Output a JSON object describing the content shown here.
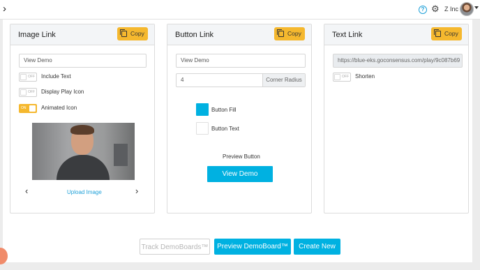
{
  "topbar": {
    "back_icon": "chevron-right-icon",
    "help_icon": "?",
    "settings_icon": "gear-icon",
    "org_name": "Z Inc",
    "avatar_icon": "user-avatar"
  },
  "image_link": {
    "title": "Image Link",
    "copy_label": "Copy",
    "input_value": "View Demo",
    "toggles": [
      {
        "state": "OFF",
        "label": "Include Text",
        "on": false
      },
      {
        "state": "OFF",
        "label": "Display Play Icon",
        "on": false
      },
      {
        "state": "ON",
        "label": "Animated Icon",
        "on": true
      }
    ],
    "prev_icon": "‹",
    "next_icon": "›",
    "upload_label": "Upload Image"
  },
  "button_link": {
    "title": "Button Link",
    "copy_label": "Copy",
    "input_value": "View Demo",
    "corner_radius_value": "4",
    "corner_radius_label": "Corner Radius",
    "swatches": [
      {
        "label": "Button Fill",
        "color": "#00b1e1"
      },
      {
        "label": "Button Text",
        "color": "#ffffff"
      }
    ],
    "preview_label": "Preview Button",
    "demo_button_label": "View Demo",
    "accent_color": "#00b1e1"
  },
  "text_link": {
    "title": "Text Link",
    "copy_label": "Copy",
    "url_value": "https://blue-eks.goconsensus.com/play/9c087b69",
    "toggle": {
      "state": "OFF",
      "label": "Shorten",
      "on": false
    }
  },
  "footer": {
    "track_label": "Track DemoBoards™",
    "preview_label": "Preview DemoBoard™",
    "create_label": "Create New"
  },
  "colors": {
    "copy_button": "#f5b82e",
    "primary": "#00b1e1",
    "toggle_on": "#f5b82e"
  }
}
